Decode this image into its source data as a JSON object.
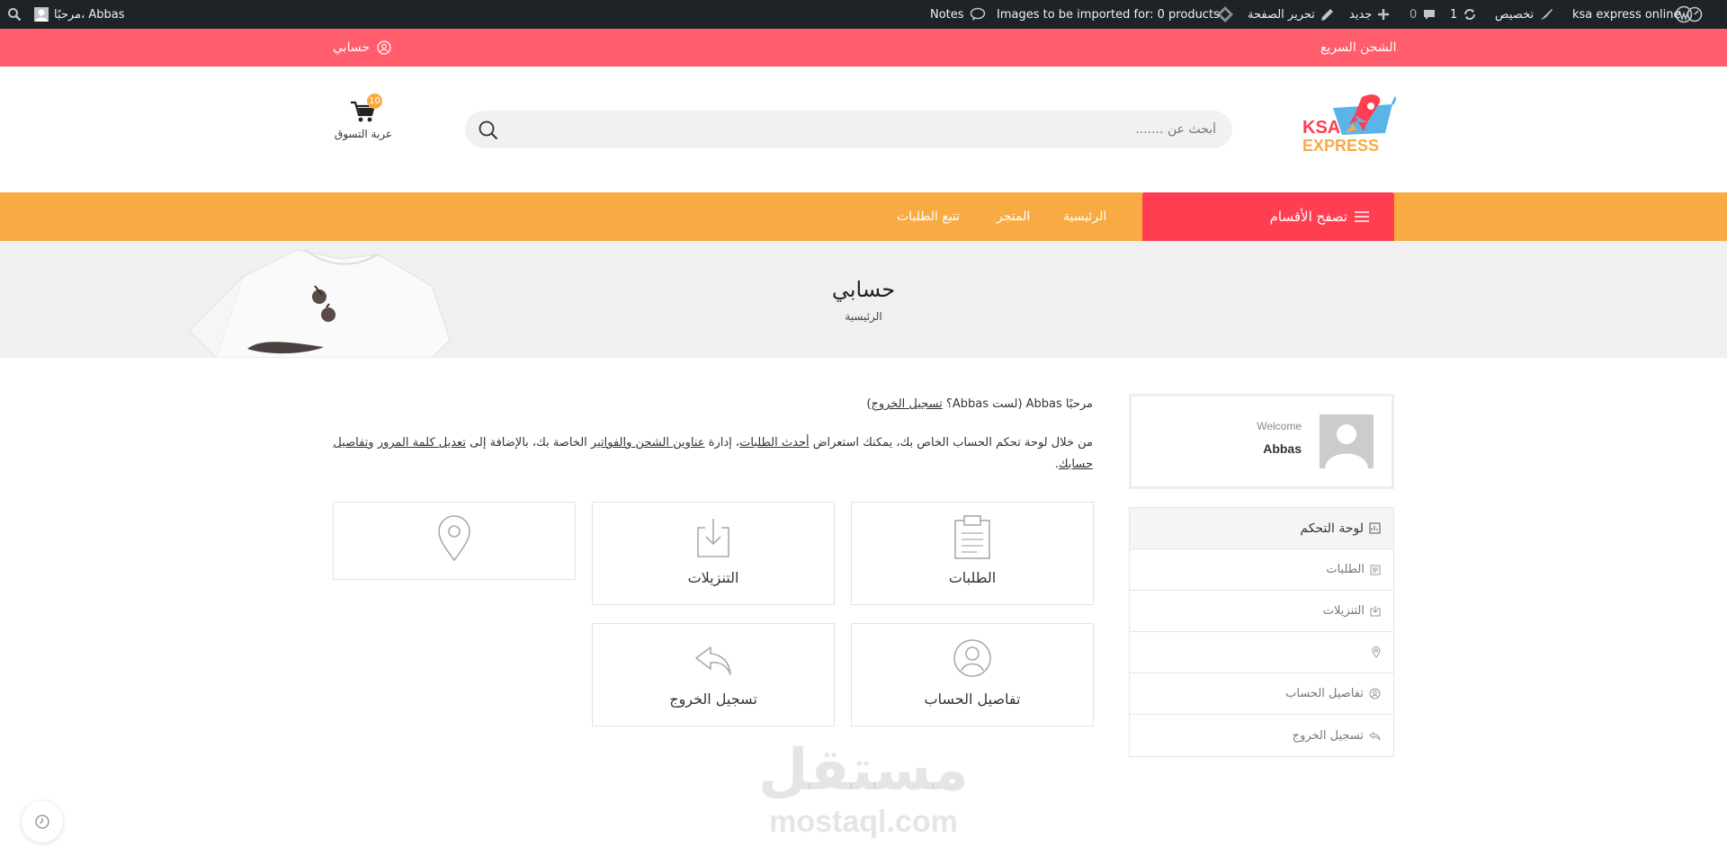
{
  "admin_bar": {
    "site_name": "ksa express online",
    "customize": "تخصيص",
    "updates_count": "1",
    "comments_count": "0",
    "new_label": "جديد",
    "edit_page": "تحرير الصفحة",
    "images_import": "Images to be imported for: 0 products",
    "notes": "Notes",
    "howdy": "مرحبًا، Abbas"
  },
  "topbar": {
    "fast_shipping": "الشحن السريع",
    "my_account": "حسابي"
  },
  "header": {
    "logo_text_1": "KSA",
    "logo_text_2": "EXPRESS",
    "search_placeholder": "أبحث عن .......",
    "cart_count": "10",
    "cart_label": "عربة التسوق"
  },
  "nav": {
    "browse_categories": "تصفح الأقسام",
    "home": "الرئيسية",
    "shop": "المتجر",
    "track_orders": "تتبع الطلبات"
  },
  "banner": {
    "title": "حسابي",
    "breadcrumb": "الرئيسية"
  },
  "content": {
    "hello_prefix": "مرحبًا Abbas (لست Abbas؟ ",
    "logout_link": "تسجيل الخروج",
    "hello_suffix": ")",
    "intro_1": "من خلال لوحة تحكم الحساب الخاص بك، يمكنك استعراض ",
    "recent_orders_link": "أحدث الطلبات",
    "intro_2": "، إدارة ",
    "addresses_link": "عناوين الشحن والفواتير",
    "intro_3": " الخاصة بك، بالإضافة إلى ",
    "edit_password_link": "تعديل كلمة المرور",
    "intro_4": " و",
    "account_details_link": "تفاصيل حسابك",
    "intro_5": ".",
    "tiles": {
      "orders": "الطلبات",
      "downloads": "التنزيلات",
      "addresses": "",
      "account_details": "تفاصيل الحساب",
      "logout": "تسجيل الخروج"
    }
  },
  "sidebar": {
    "welcome": "Welcome",
    "username": "Abbas",
    "menu": [
      {
        "label": "لوحة التحكم"
      },
      {
        "label": "الطلبات"
      },
      {
        "label": "التنزيلات"
      },
      {
        "label": ""
      },
      {
        "label": "تفاصيل الحساب"
      },
      {
        "label": "تسجيل الخروج"
      }
    ]
  },
  "watermark": {
    "arabic": "مستقل",
    "latin": "mostaql.com"
  },
  "colors": {
    "admin_bar": "#1d2327",
    "top_bar": "#ff5d6c",
    "nav": "#f9ab43",
    "browse": "#ff3e52"
  }
}
